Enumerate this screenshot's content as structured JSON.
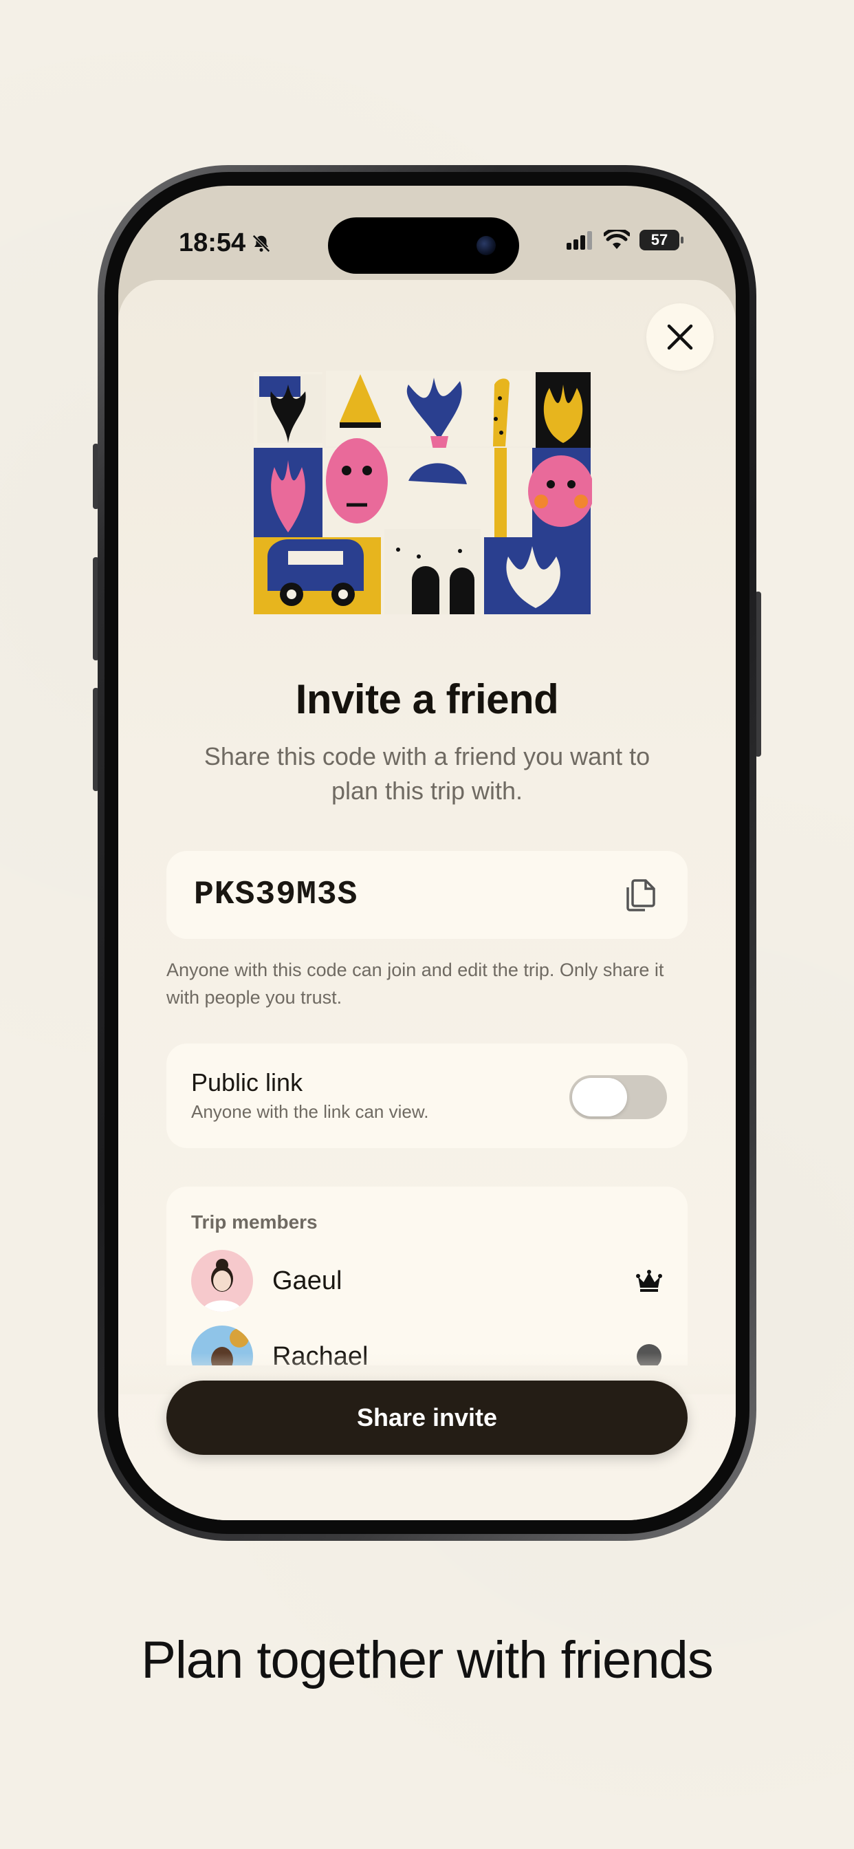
{
  "status_bar": {
    "time": "18:54",
    "battery": "57"
  },
  "invite": {
    "title": "Invite a friend",
    "subtitle": "Share this code with a friend you want to plan this trip with.",
    "code": "PKS39M3S",
    "code_note": "Anyone with this code can join and edit the trip. Only share it with people you trust."
  },
  "public_link": {
    "title": "Public link",
    "subtitle": "Anyone with the link can view.",
    "enabled": false
  },
  "members": {
    "title": "Trip members",
    "items": [
      {
        "name": "Gaeul",
        "role_icon": "crown-icon"
      },
      {
        "name": "Rachael",
        "role_icon": "dot-icon"
      }
    ]
  },
  "share_button": {
    "label": "Share invite"
  },
  "caption": "Plan together with friends",
  "colors": {
    "background": "#f4f0e7",
    "sheet": "#f5f0e6",
    "card": "#fdf9f0",
    "button": "#241d15",
    "text_primary": "#15120d",
    "text_secondary": "#6f6a62"
  }
}
